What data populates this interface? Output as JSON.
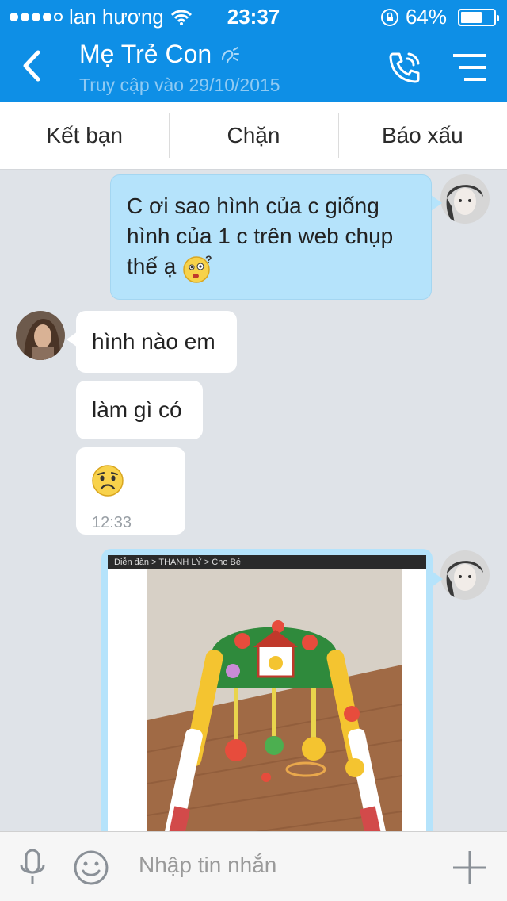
{
  "status": {
    "carrier": "lan hương",
    "time": "23:37",
    "battery": "64%",
    "battery_level": 0.64,
    "signal_bars": 4
  },
  "header": {
    "contact_name": "Mẹ Trẻ Con",
    "last_seen": "Truy cập vào 29/10/2015"
  },
  "actions": {
    "add_friend": "Kết bạn",
    "block": "Chặn",
    "report": "Báo xấu"
  },
  "messages": {
    "m1": "C ơi sao hình của c giống hình của 1 c trên web chụp thế ạ",
    "m2": "hình nào em",
    "m3": "làm gì có",
    "m4_time": "12:33",
    "image_caption": "Diễn đàn > THANH LÝ > Cho Bé"
  },
  "composer": {
    "placeholder": "Nhập tin nhắn"
  },
  "colors": {
    "header": "#0e8fe6",
    "outgoing_bubble": "#b5e3fb",
    "incoming_bubble": "#ffffff",
    "background": "#dfe3e8"
  },
  "icons": [
    "back-icon",
    "sound-icon",
    "phone-icon",
    "menu-icon",
    "mic-icon",
    "smiley-icon",
    "plus-icon",
    "confused-emoji",
    "sad-emoji",
    "wifi-icon",
    "rotation-lock-icon"
  ]
}
